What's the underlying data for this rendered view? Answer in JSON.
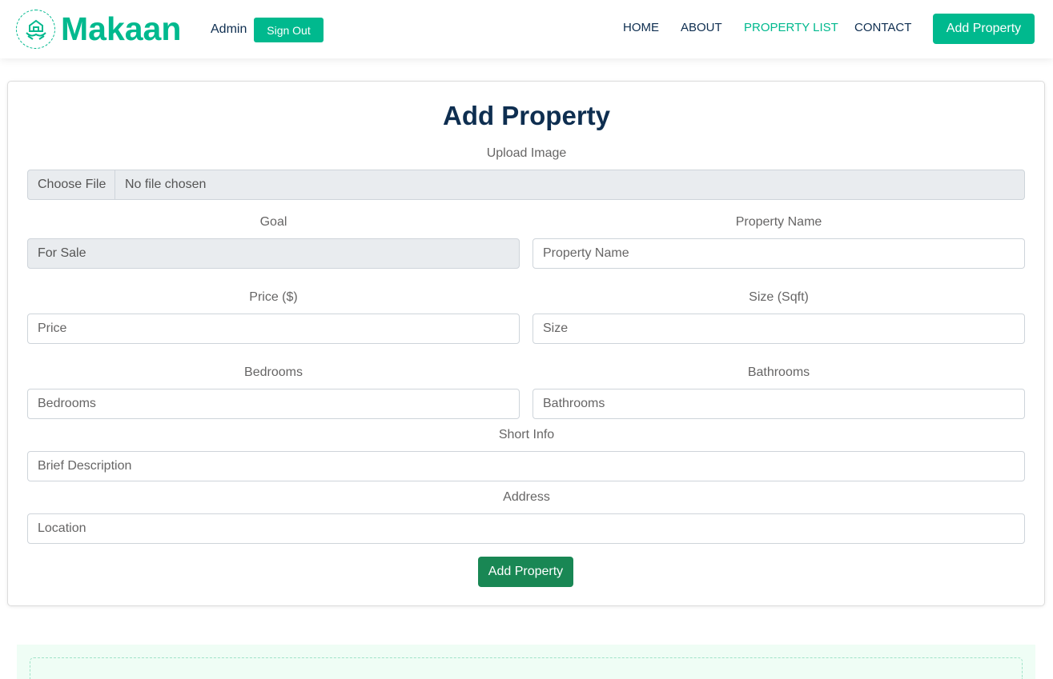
{
  "navbar": {
    "brand": "Makaan",
    "user_label": "Admin",
    "signout_label": "Sign Out",
    "links": [
      {
        "label": "HOME",
        "active": false
      },
      {
        "label": "ABOUT",
        "active": false
      },
      {
        "label": "PROPERTY LIST",
        "active": true
      },
      {
        "label": "CONTACT",
        "active": false
      }
    ],
    "add_button_label": "Add Property",
    "logo_icon": "house-hands-icon"
  },
  "form": {
    "title": "Add Property",
    "upload": {
      "label": "Upload Image",
      "button": "Choose File",
      "status": "No file chosen"
    },
    "goal": {
      "label": "Goal",
      "value": "For Sale"
    },
    "property_name": {
      "label": "Property Name",
      "placeholder": "Property Name"
    },
    "price": {
      "label": "Price ($)",
      "placeholder": "Price"
    },
    "size": {
      "label": "Size (Sqft)",
      "placeholder": "Size"
    },
    "bedrooms": {
      "label": "Bedrooms",
      "placeholder": "Bedrooms"
    },
    "bathrooms": {
      "label": "Bathrooms",
      "placeholder": "Bathrooms"
    },
    "short_info": {
      "label": "Short Info",
      "placeholder": "Brief Description"
    },
    "address": {
      "label": "Address",
      "placeholder": "Location"
    },
    "submit_label": "Add Property"
  },
  "colors": {
    "brand": "#00B98E",
    "dark": "#0E2E50",
    "submit": "#198754"
  }
}
